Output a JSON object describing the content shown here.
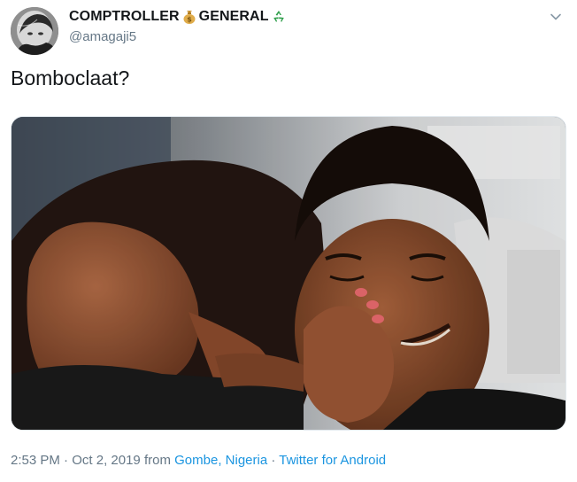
{
  "author": {
    "name_part1": "COMPTROLLER",
    "name_part2": "GENERAL",
    "emoji1": "money-bag-icon",
    "emoji2": "recycle-icon",
    "handle": "@amagaji5"
  },
  "tweet": {
    "text": "Bomboclaat?"
  },
  "meta": {
    "time": "2:53 PM",
    "separator1": " · ",
    "date": "Oct 2, 2019",
    "from": " from ",
    "location": "Gombe, Nigeria",
    "separator2": " · ",
    "client": "Twitter for Android"
  },
  "colors": {
    "text_primary": "#14171a",
    "text_secondary": "#657786",
    "link": "#1b95e0",
    "recycle": "#2e9e4a",
    "money_bag": "#d9a441"
  }
}
